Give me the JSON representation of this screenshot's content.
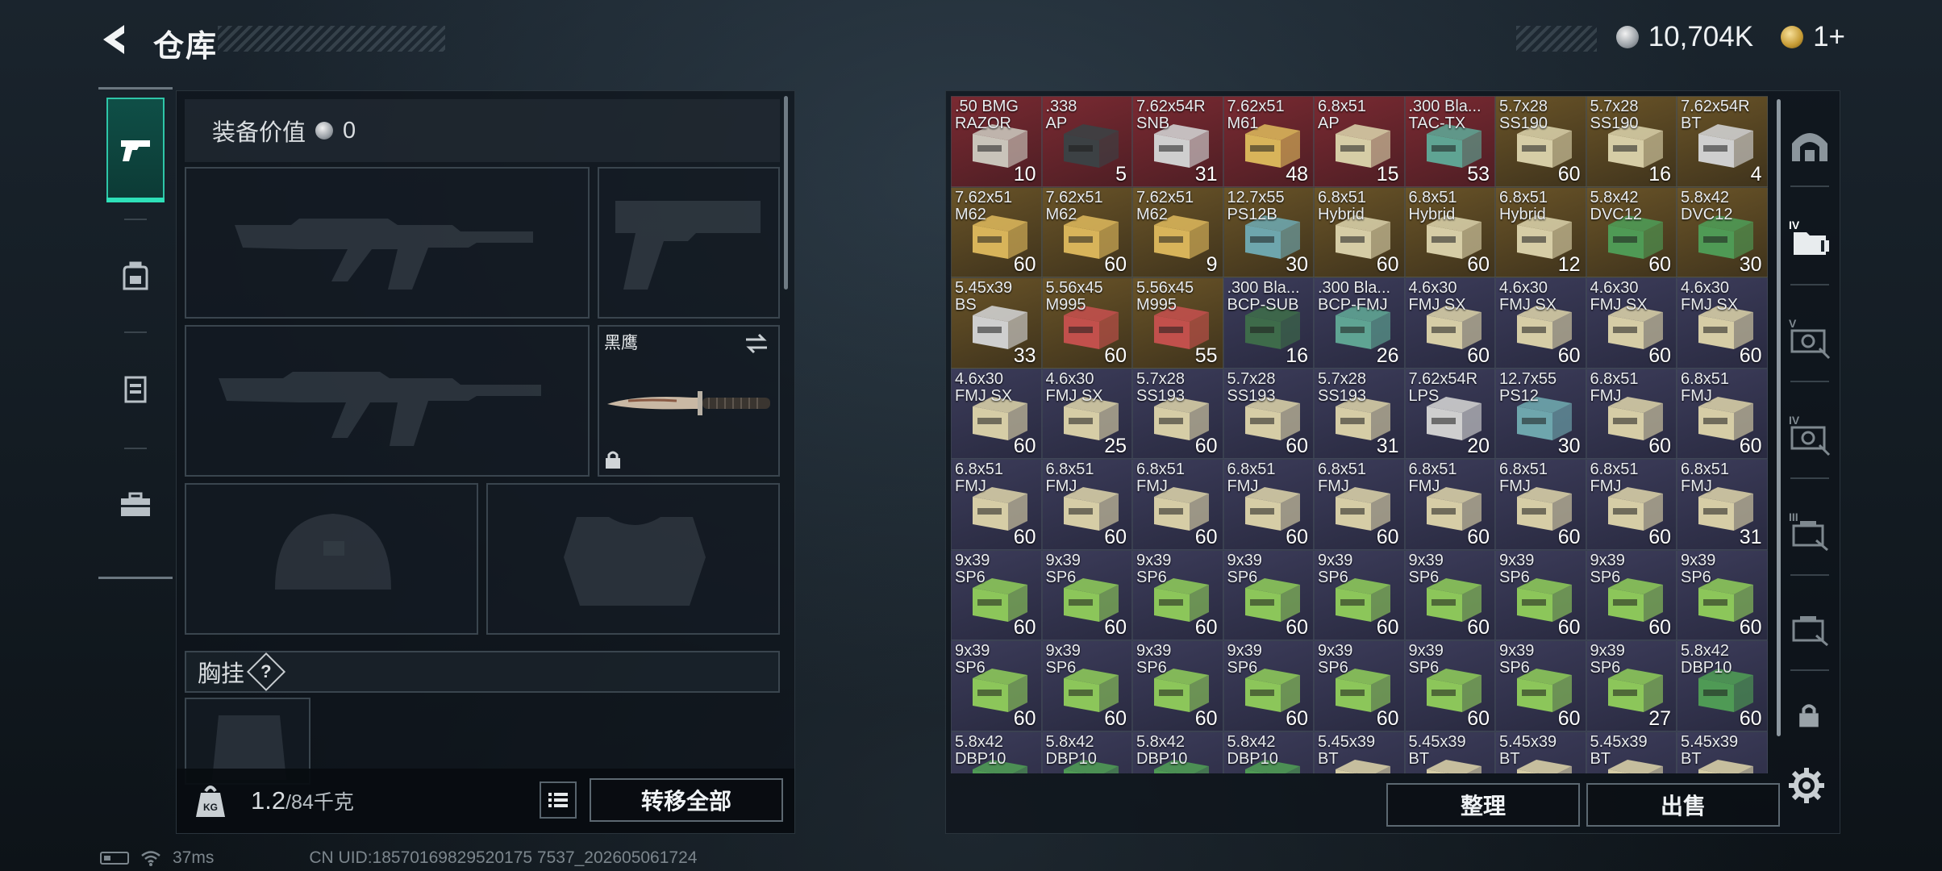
{
  "header": {
    "title": "仓库",
    "currency_amount": "10,704K",
    "token_amount": "1+"
  },
  "equipment": {
    "value_label": "装备价值",
    "value": "0",
    "knife_label": "黑鹰",
    "chest_label": "胸挂",
    "chest_help": "?",
    "weight_current": "1.2",
    "weight_max": "/84千克",
    "transfer_all": "转移全部"
  },
  "storage": {
    "sort_button": "整理",
    "sell_button": "出售",
    "items": [
      {
        "name": ".50 BMG\nRAZOR",
        "qty": "10",
        "tone": "red",
        "box": "#c9c4ba"
      },
      {
        "name": ".338\nAP",
        "qty": "5",
        "tone": "red",
        "box": "#3c4144"
      },
      {
        "name": "7.62x54R\nSNB",
        "qty": "31",
        "tone": "red",
        "box": "#cfcfcf"
      },
      {
        "name": "7.62x51\nM61",
        "qty": "48",
        "tone": "red",
        "box": "#d8b45a"
      },
      {
        "name": "6.8x51\nAP",
        "qty": "15",
        "tone": "red",
        "box": "#d6cda6"
      },
      {
        "name": ".300 Bla...\nTAC-TX",
        "qty": "53",
        "tone": "red",
        "box": "#5fa493"
      },
      {
        "name": "5.7x28\nSS190",
        "qty": "60",
        "tone": "gold",
        "box": "#d6cda6"
      },
      {
        "name": "5.7x28\nSS190",
        "qty": "16",
        "tone": "gold",
        "box": "#d6cda6"
      },
      {
        "name": "7.62x54R\nBT",
        "qty": "4",
        "tone": "gold",
        "box": "#cfcfcf"
      },
      {
        "name": "7.62x51\nM62",
        "qty": "60",
        "tone": "gold",
        "box": "#d8b45a"
      },
      {
        "name": "7.62x51\nM62",
        "qty": "60",
        "tone": "gold",
        "box": "#d8b45a"
      },
      {
        "name": "7.62x51\nM62",
        "qty": "9",
        "tone": "gold",
        "box": "#d8b45a"
      },
      {
        "name": "12.7x55\nPS12B",
        "qty": "30",
        "tone": "gold",
        "box": "#6ea6ad"
      },
      {
        "name": "6.8x51\nHybrid",
        "qty": "60",
        "tone": "gold",
        "box": "#d6cda6"
      },
      {
        "name": "6.8x51\nHybrid",
        "qty": "60",
        "tone": "gold",
        "box": "#d6cda6"
      },
      {
        "name": "6.8x51\nHybrid",
        "qty": "12",
        "tone": "gold",
        "box": "#d6cda6"
      },
      {
        "name": "5.8x42\nDVC12",
        "qty": "60",
        "tone": "gold",
        "box": "#4f9a55"
      },
      {
        "name": "5.8x42\nDVC12",
        "qty": "30",
        "tone": "gold",
        "box": "#4f9a55"
      },
      {
        "name": "5.45x39\nBS",
        "qty": "33",
        "tone": "gold",
        "box": "#cfcfcf"
      },
      {
        "name": "5.56x45\nM995",
        "qty": "60",
        "tone": "gold",
        "box": "#c2504c"
      },
      {
        "name": "5.56x45\nM995",
        "qty": "55",
        "tone": "gold",
        "box": "#c2504c"
      },
      {
        "name": ".300 Bla...\nBCP-SUB",
        "qty": "16",
        "tone": "purple",
        "box": "#3e6b4a"
      },
      {
        "name": ".300 Bla...\nBCP-FMJ",
        "qty": "26",
        "tone": "purple",
        "box": "#5fa493"
      },
      {
        "name": "4.6x30\nFMJ SX",
        "qty": "60",
        "tone": "purple",
        "box": "#d6cda6"
      },
      {
        "name": "4.6x30\nFMJ SX",
        "qty": "60",
        "tone": "purple",
        "box": "#d6cda6"
      },
      {
        "name": "4.6x30\nFMJ SX",
        "qty": "60",
        "tone": "purple",
        "box": "#d6cda6"
      },
      {
        "name": "4.6x30\nFMJ SX",
        "qty": "60",
        "tone": "purple",
        "box": "#d6cda6"
      },
      {
        "name": "4.6x30\nFMJ SX",
        "qty": "60",
        "tone": "purple",
        "box": "#d6cda6"
      },
      {
        "name": "4.6x30\nFMJ SX",
        "qty": "25",
        "tone": "purple",
        "box": "#d6cda6"
      },
      {
        "name": "5.7x28\nSS193",
        "qty": "60",
        "tone": "purple",
        "box": "#d6cda6"
      },
      {
        "name": "5.7x28\nSS193",
        "qty": "60",
        "tone": "purple",
        "box": "#d6cda6"
      },
      {
        "name": "5.7x28\nSS193",
        "qty": "31",
        "tone": "purple",
        "box": "#d6cda6"
      },
      {
        "name": "7.62x54R\nLPS",
        "qty": "20",
        "tone": "purple",
        "box": "#cfcfcf"
      },
      {
        "name": "12.7x55\nPS12",
        "qty": "30",
        "tone": "purple",
        "box": "#6ea6ad"
      },
      {
        "name": "6.8x51\nFMJ",
        "qty": "60",
        "tone": "purple",
        "box": "#d6cda6"
      },
      {
        "name": "6.8x51\nFMJ",
        "qty": "60",
        "tone": "purple",
        "box": "#d6cda6"
      },
      {
        "name": "6.8x51\nFMJ",
        "qty": "60",
        "tone": "purple",
        "box": "#d6cda6"
      },
      {
        "name": "6.8x51\nFMJ",
        "qty": "60",
        "tone": "purple",
        "box": "#d6cda6"
      },
      {
        "name": "6.8x51\nFMJ",
        "qty": "60",
        "tone": "purple",
        "box": "#d6cda6"
      },
      {
        "name": "6.8x51\nFMJ",
        "qty": "60",
        "tone": "purple",
        "box": "#d6cda6"
      },
      {
        "name": "6.8x51\nFMJ",
        "qty": "60",
        "tone": "purple",
        "box": "#d6cda6"
      },
      {
        "name": "6.8x51\nFMJ",
        "qty": "60",
        "tone": "purple",
        "box": "#d6cda6"
      },
      {
        "name": "6.8x51\nFMJ",
        "qty": "60",
        "tone": "purple",
        "box": "#d6cda6"
      },
      {
        "name": "6.8x51\nFMJ",
        "qty": "60",
        "tone": "purple",
        "box": "#d6cda6"
      },
      {
        "name": "6.8x51\nFMJ",
        "qty": "31",
        "tone": "purple",
        "box": "#d6cda6"
      },
      {
        "name": "9x39\nSP6",
        "qty": "60",
        "tone": "purple",
        "box": "#8cc65a"
      },
      {
        "name": "9x39\nSP6",
        "qty": "60",
        "tone": "purple",
        "box": "#8cc65a"
      },
      {
        "name": "9x39\nSP6",
        "qty": "60",
        "tone": "purple",
        "box": "#8cc65a"
      },
      {
        "name": "9x39\nSP6",
        "qty": "60",
        "tone": "purple",
        "box": "#8cc65a"
      },
      {
        "name": "9x39\nSP6",
        "qty": "60",
        "tone": "purple",
        "box": "#8cc65a"
      },
      {
        "name": "9x39\nSP6",
        "qty": "60",
        "tone": "purple",
        "box": "#8cc65a"
      },
      {
        "name": "9x39\nSP6",
        "qty": "60",
        "tone": "purple",
        "box": "#8cc65a"
      },
      {
        "name": "9x39\nSP6",
        "qty": "60",
        "tone": "purple",
        "box": "#8cc65a"
      },
      {
        "name": "9x39\nSP6",
        "qty": "60",
        "tone": "purple",
        "box": "#8cc65a"
      },
      {
        "name": "9x39\nSP6",
        "qty": "60",
        "tone": "purple",
        "box": "#8cc65a"
      },
      {
        "name": "9x39\nSP6",
        "qty": "60",
        "tone": "purple",
        "box": "#8cc65a"
      },
      {
        "name": "9x39\nSP6",
        "qty": "60",
        "tone": "purple",
        "box": "#8cc65a"
      },
      {
        "name": "9x39\nSP6",
        "qty": "60",
        "tone": "purple",
        "box": "#8cc65a"
      },
      {
        "name": "9x39\nSP6",
        "qty": "60",
        "tone": "purple",
        "box": "#8cc65a"
      },
      {
        "name": "9x39\nSP6",
        "qty": "60",
        "tone": "purple",
        "box": "#8cc65a"
      },
      {
        "name": "9x39\nSP6",
        "qty": "60",
        "tone": "purple",
        "box": "#8cc65a"
      },
      {
        "name": "9x39\nSP6",
        "qty": "27",
        "tone": "purple",
        "box": "#8cc65a"
      },
      {
        "name": "5.8x42\nDBP10",
        "qty": "60",
        "tone": "purple",
        "box": "#4f9a55"
      },
      {
        "name": "5.8x42\nDBP10",
        "qty": "",
        "tone": "purple",
        "box": "#4f9a55"
      },
      {
        "name": "5.8x42\nDBP10",
        "qty": "",
        "tone": "purple",
        "box": "#4f9a55"
      },
      {
        "name": "5.8x42\nDBP10",
        "qty": "",
        "tone": "purple",
        "box": "#4f9a55"
      },
      {
        "name": "5.8x42\nDBP10",
        "qty": "",
        "tone": "purple",
        "box": "#4f9a55"
      },
      {
        "name": "5.45x39\nBT",
        "qty": "",
        "tone": "purple",
        "box": "#d6cda6"
      },
      {
        "name": "5.45x39\nBT",
        "qty": "",
        "tone": "purple",
        "box": "#d6cda6"
      },
      {
        "name": "5.45x39\nBT",
        "qty": "",
        "tone": "purple",
        "box": "#d6cda6"
      },
      {
        "name": "5.45x39\nBT",
        "qty": "",
        "tone": "purple",
        "box": "#d6cda6"
      },
      {
        "name": "5.45x39\nBT",
        "qty": "",
        "tone": "purple",
        "box": "#d6cda6"
      }
    ]
  },
  "side_icons": [
    {
      "icon": "shelter-icon"
    },
    {
      "icon": "folder-iv-icon"
    },
    {
      "icon": "case-v-icon"
    },
    {
      "icon": "case-iv-icon"
    },
    {
      "icon": "box-iii-icon"
    },
    {
      "icon": "box-icon"
    },
    {
      "icon": "lock-icon"
    }
  ],
  "status": {
    "ping": "37ms",
    "uid": "CN UID:18570169829520175 7537_202605061724"
  }
}
